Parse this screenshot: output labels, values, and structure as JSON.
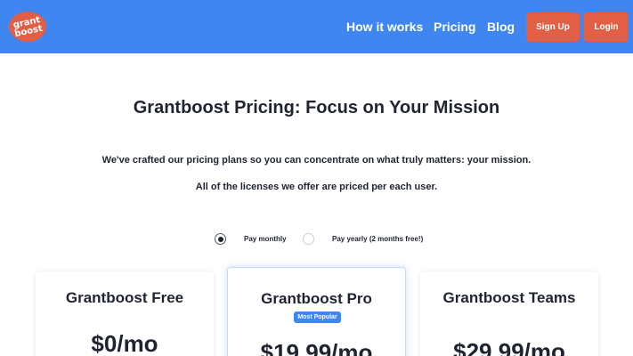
{
  "nav": {
    "logo_text": "grantboost",
    "links": [
      "How it works",
      "Pricing",
      "Blog"
    ],
    "signup_label": "Sign Up",
    "login_label": "Login"
  },
  "hero": {
    "title": "Grantboost Pricing: Focus on Your Mission",
    "subtitle_1": "We've crafted our pricing plans so you can concentrate on what truly matters: your mission.",
    "subtitle_2": "All of the licenses we offer are priced per each user."
  },
  "billing": {
    "monthly_label": "Pay monthly",
    "yearly_label": "Pay yearly (2 months free!)",
    "selected": "monthly"
  },
  "plans": [
    {
      "name": "Grantboost Free",
      "price": "$0/mo"
    },
    {
      "name": "Grantboost Pro",
      "badge": "Most Popular",
      "price": "$19.99/mo"
    },
    {
      "name": "Grantboost Teams",
      "price": "$29.99/mo"
    }
  ],
  "colors": {
    "brand_blue": "#3f86f0",
    "accent_orange": "#e25e45",
    "text_dark": "#1f2430"
  }
}
